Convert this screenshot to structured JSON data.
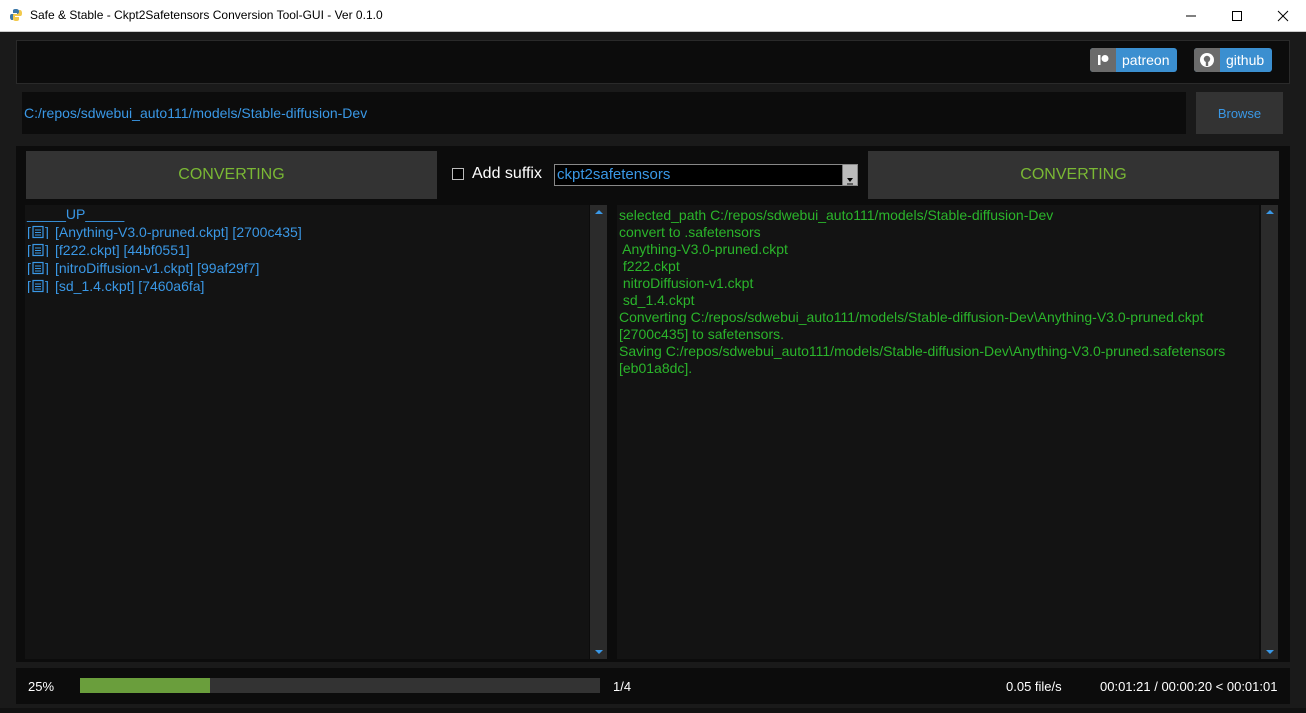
{
  "window": {
    "title": "Safe & Stable - Ckpt2Safetensors Conversion Tool-GUI - Ver 0.1.0"
  },
  "header": {
    "patreon_label": "patreon",
    "github_label": "github"
  },
  "path_bar": {
    "path": "C:/repos/sdwebui_auto111/models/Stable-diffusion-Dev",
    "browse_label": "Browse"
  },
  "controls": {
    "left_convert_label": "CONVERTING",
    "add_suffix_label": "Add suffix",
    "add_suffix_checked": false,
    "suffix_value": "ckpt2safetensors",
    "right_convert_label": "CONVERTING"
  },
  "file_list": {
    "up_item": "_____UP_____",
    "items": [
      {
        "name": "[Anything-V3.0-pruned.ckpt] [2700c435]",
        "icon": "file-icon"
      },
      {
        "name": "[f222.ckpt] [44bf0551]",
        "icon": "file-icon"
      },
      {
        "name": "[nitroDiffusion-v1.ckpt] [99af29f7]",
        "icon": "file-icon"
      },
      {
        "name": "[sd_1.4.ckpt] [7460a6fa]",
        "icon": "file-icon"
      }
    ]
  },
  "log": {
    "lines": [
      "selected_path C:/repos/sdwebui_auto111/models/Stable-diffusion-Dev",
      "convert to .safetensors",
      " Anything-V3.0-pruned.ckpt",
      " f222.ckpt",
      " nitroDiffusion-v1.ckpt",
      " sd_1.4.ckpt",
      "Converting C:/repos/sdwebui_auto111/models/Stable-diffusion-Dev\\Anything-V3.0-pruned.ckpt",
      "[2700c435] to safetensors.",
      "Saving C:/repos/sdwebui_auto111/models/Stable-diffusion-Dev\\Anything-V3.0-pruned.safetensors",
      "[eb01a8dc]."
    ]
  },
  "status": {
    "percent_label": "25%",
    "progress_fraction": 0.25,
    "count_label": "1/4",
    "rate_label": "0.05 file/s",
    "time_label": "00:01:21 / 00:00:20 < 00:01:01"
  },
  "colors": {
    "accent_blue": "#3a98e6",
    "log_green": "#2bb52b",
    "convert_green": "#7ab834",
    "progress_green": "#6a9e3c"
  }
}
